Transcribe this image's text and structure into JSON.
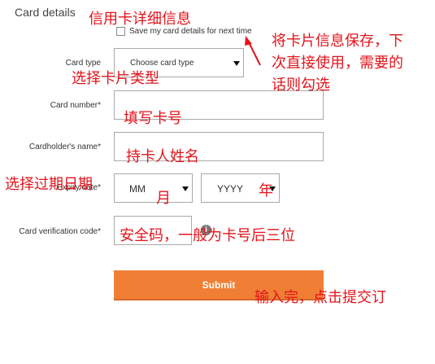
{
  "form": {
    "title": "Card details",
    "save_checkbox_label": "Save my card details for next time",
    "card_type": {
      "label": "Card type",
      "value": "Choose card type"
    },
    "card_number": {
      "label": "Card number*",
      "value": ""
    },
    "cardholder_name": {
      "label": "Cardholder's name*",
      "value": ""
    },
    "expiry": {
      "label": "Expiry date*",
      "month_value": "MM",
      "year_value": "YYYY"
    },
    "cvc": {
      "label": "Card verification code*",
      "value": "",
      "help_glyph": "i"
    },
    "submit_label": "Submit"
  },
  "annotations": {
    "card_details": "信用卡详细信息",
    "save_hint_line1": "将卡片信息保存，下",
    "save_hint_line2": "次直接使用，需要的",
    "save_hint_line3": "话则勾选",
    "select_card_type": "选择卡片类型",
    "fill_card_number": "填写卡号",
    "cardholder_name": "持卡人姓名",
    "select_expiry": "选择过期日期",
    "month": "月",
    "year": "年",
    "cvc_hint": "安全码，一般为卡号后三位",
    "submit_hint": "输入完，点击提交订"
  },
  "colors": {
    "accent": "#f07f35",
    "annotation": "#e3141b"
  }
}
